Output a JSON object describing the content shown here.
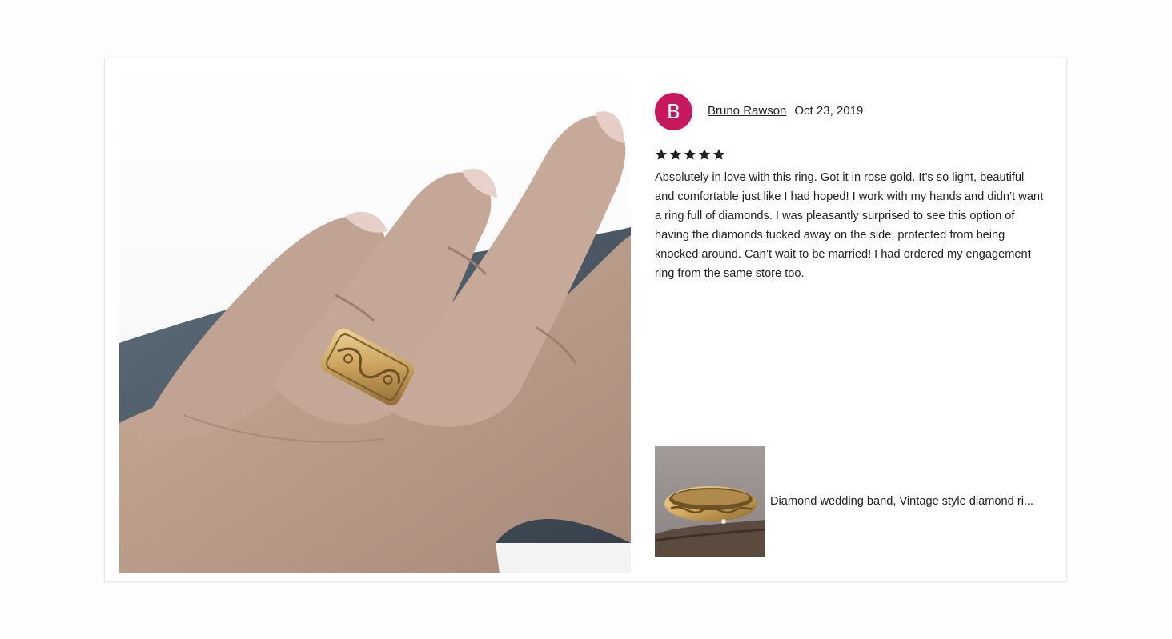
{
  "review": {
    "avatar_initial": "B",
    "avatar_color": "#c8175e",
    "reviewer_name": "Bruno Rawson",
    "date": "Oct 23, 2019",
    "rating": 5,
    "rating_max": 5,
    "text": "Absolutely in love with this ring. Got it in rose gold. It’s so light, beautiful and comfortable just like I had hoped! I work with my hands and didn’t want a ring full of diamonds. I was pleasantly surprised to see this option of having the diamonds tucked away on the side, protected from being knocked around. Can’t wait to be married! I had ordered my engagement ring from the same store too."
  },
  "product": {
    "title": "Diamond wedding band, Vintage style diamond ri..."
  },
  "colors": {
    "star": "#222222",
    "accent": "#c8175e"
  }
}
